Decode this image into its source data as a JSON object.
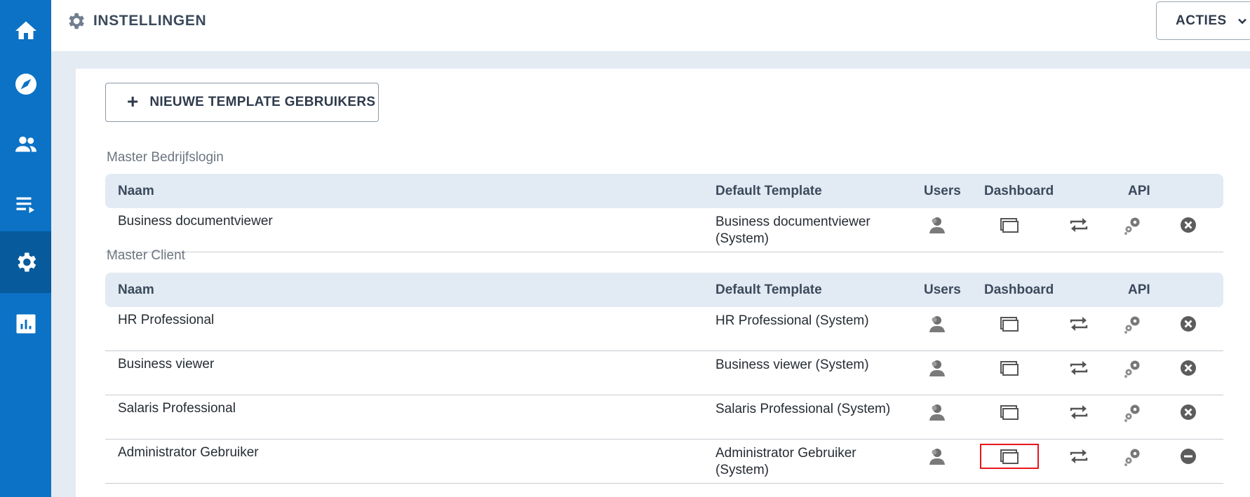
{
  "header": {
    "title": "INSTELLINGEN",
    "title_icon": "gear-icon",
    "actions_label": "ACTIES",
    "actions_icon": "chevron-down-icon"
  },
  "sidebar": {
    "items": [
      {
        "name": "home",
        "icon": "home-icon",
        "active": false
      },
      {
        "name": "explore",
        "icon": "compass-icon",
        "active": false
      },
      {
        "name": "users",
        "icon": "users-icon",
        "active": false
      },
      {
        "name": "playlist",
        "icon": "list-play-icon",
        "active": false
      },
      {
        "name": "settings",
        "icon": "gear-icon",
        "active": true
      },
      {
        "name": "reports",
        "icon": "bar-chart-icon",
        "active": false
      }
    ]
  },
  "toolbar": {
    "new_button_label": "NIEUWE TEMPLATE GEBRUIKERS"
  },
  "columns": {
    "naam": "Naam",
    "default_template": "Default Template",
    "users": "Users",
    "dashboard": "Dashboard",
    "api": "API"
  },
  "sections": [
    {
      "title": "Master Bedrijfslogin",
      "rows": [
        {
          "naam": "Business documentviewer",
          "template": "Business documentviewer (System)",
          "remove_icon": "close-circle-icon"
        }
      ]
    },
    {
      "title": "Master Client",
      "rows": [
        {
          "naam": "HR Professional",
          "template": "HR Professional (System)",
          "remove_icon": "close-circle-icon"
        },
        {
          "naam": "Business viewer",
          "template": "Business viewer (System)",
          "remove_icon": "close-circle-icon"
        },
        {
          "naam": "Salaris Professional",
          "template": "Salaris Professional (System)",
          "remove_icon": "close-circle-icon"
        },
        {
          "naam": "Administrator Gebruiker",
          "template": "Administrator Gebruiker (System)",
          "remove_icon": "minus-circle-icon"
        }
      ]
    }
  ],
  "colors": {
    "sidebar": "#0b72c5",
    "sidebar_active": "#075a9c",
    "highlight": "#e8151b"
  }
}
